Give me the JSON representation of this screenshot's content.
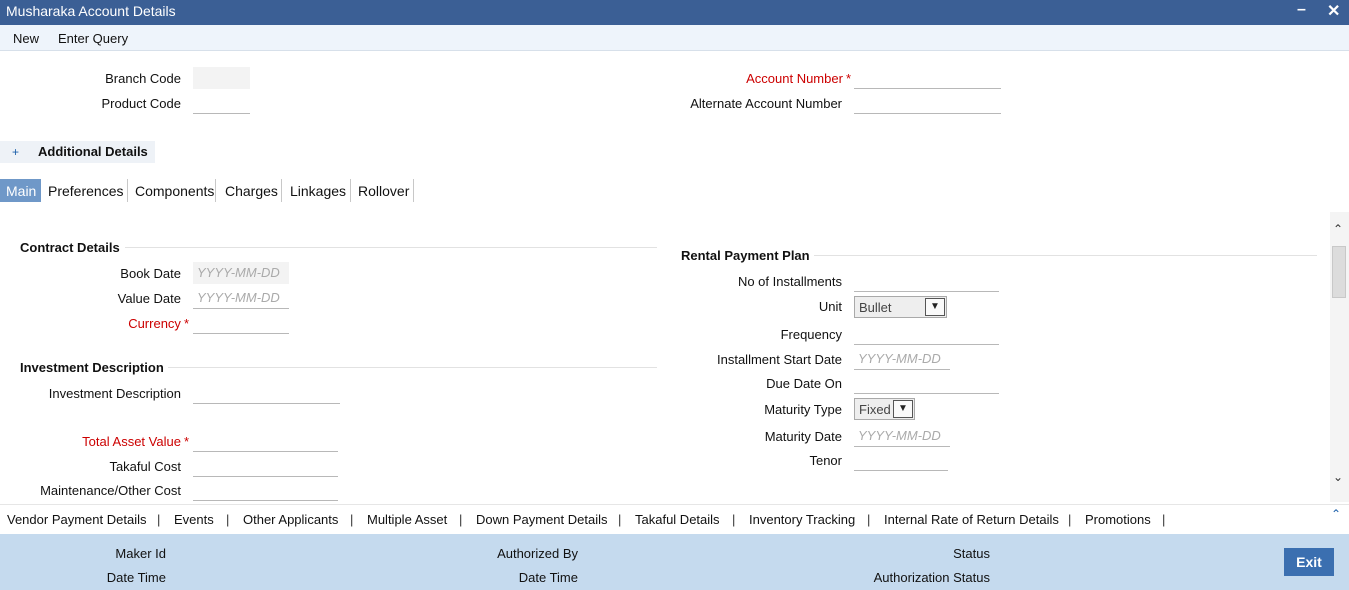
{
  "window": {
    "title": "Musharaka Account Details"
  },
  "menu": {
    "new": "New",
    "enter_query": "Enter Query"
  },
  "header": {
    "branch_code_label": "Branch Code",
    "product_code_label": "Product Code",
    "account_number_label": "Account Number",
    "alternate_account_number_label": "Alternate Account Number",
    "required_mark": "*"
  },
  "additional_details": {
    "label": "Additional Details",
    "toggle": "+"
  },
  "tabs": [
    {
      "label": "Main"
    },
    {
      "label": "Preferences"
    },
    {
      "label": "Components"
    },
    {
      "label": "Charges"
    },
    {
      "label": "Linkages"
    },
    {
      "label": "Rollover"
    }
  ],
  "contract_details": {
    "title": "Contract Details",
    "book_date_label": "Book Date",
    "book_date_placeholder": "YYYY-MM-DD",
    "value_date_label": "Value Date",
    "value_date_placeholder": "YYYY-MM-DD",
    "currency_label": "Currency"
  },
  "investment": {
    "title": "Investment Description",
    "description_label": "Investment Description",
    "total_asset_value_label": "Total Asset Value",
    "takaful_cost_label": "Takaful Cost",
    "maintenance_cost_label": "Maintenance/Other Cost"
  },
  "rental_plan": {
    "title": "Rental Payment Plan",
    "no_of_installments_label": "No of Installments",
    "unit_label": "Unit",
    "unit_value": "Bullet",
    "frequency_label": "Frequency",
    "installment_start_date_label": "Installment Start Date",
    "installment_start_date_placeholder": "YYYY-MM-DD",
    "due_date_on_label": "Due Date On",
    "maturity_type_label": "Maturity Type",
    "maturity_type_value": "Fixed",
    "maturity_date_label": "Maturity Date",
    "maturity_date_placeholder": "YYYY-MM-DD",
    "tenor_label": "Tenor"
  },
  "bottom_links": [
    "Vendor Payment Details",
    "Events",
    "Other Applicants",
    "Multiple Asset",
    "Down Payment Details",
    "Takaful Details",
    "Inventory Tracking",
    "Internal Rate of Return Details",
    "Promotions"
  ],
  "footer": {
    "maker_id_label": "Maker Id",
    "maker_date_time_label": "Date Time",
    "authorized_by_label": "Authorized By",
    "auth_date_time_label": "Date Time",
    "status_label": "Status",
    "authorization_status_label": "Authorization Status",
    "exit_label": "Exit"
  },
  "colors": {
    "titlebar": "#3b5f95",
    "active_tab": "#6f98c8",
    "required": "#cc0000",
    "footer": "#c5daee",
    "exit_button": "#3b6fb0"
  }
}
